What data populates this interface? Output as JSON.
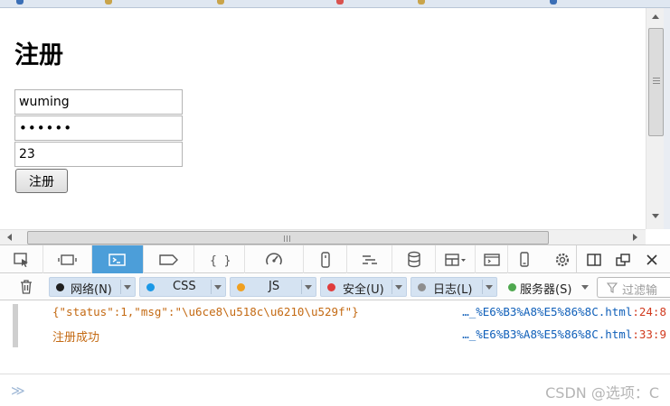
{
  "page": {
    "heading": "注册",
    "username_value": "wuming",
    "password_value": "••••••",
    "age_value": "23",
    "register_label": "注册"
  },
  "devtools": {
    "tabs": [
      "inspector-icon",
      "responsive-icon",
      "console-icon",
      "debugger-icon",
      "style-editor-icon",
      "performance-icon",
      "memory-icon",
      "network-icon",
      "storage-icon",
      "layout-icon",
      "scratchpad-icon",
      "device-icon",
      "settings-icon"
    ],
    "selected_tab": "console-icon",
    "filters": [
      {
        "label": "网络(N)",
        "color": "#1f1f1f"
      },
      {
        "label": "CSS",
        "color": "#1a98e6"
      },
      {
        "label": "JS",
        "color": "#f0a020"
      },
      {
        "label": "安全(U)",
        "color": "#e03c3c"
      },
      {
        "label": "日志(L)",
        "color": "#8e8e8e"
      },
      {
        "label": "服务器(S)",
        "color": "#4fa84f"
      }
    ],
    "filter_placeholder": "过滤输",
    "log": [
      {
        "message": "{\"status\":1,\"msg\":\"\\u6ce8\\u518c\\u6210\\u529f\"}",
        "source": "…_%E6%B3%A8%E5%86%8C.html",
        "location": ":24:8"
      },
      {
        "message": "注册成功",
        "source": "…_%E6%B3%A8%E5%86%8C.html",
        "location": ":33:9"
      }
    ],
    "prompt": "≫",
    "watermark": "CSDN @选项：C"
  }
}
